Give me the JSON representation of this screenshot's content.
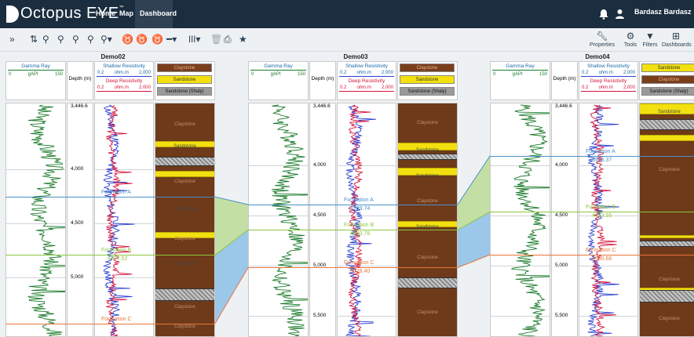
{
  "app": {
    "logo_letter": "B",
    "title": "Octopus EYE",
    "tm": "™"
  },
  "nav": {
    "items": [
      "Home",
      "Map",
      "Dashboard"
    ],
    "active": "Dashboard",
    "user": "Bardasz Bardasz"
  },
  "toolbar": {
    "right": [
      {
        "label": "Properties",
        "icon": "wrench-icon"
      },
      {
        "label": "Tools",
        "icon": "tools-icon"
      },
      {
        "label": "Filters",
        "icon": "filter-icon"
      },
      {
        "label": "Dashboards",
        "icon": "grid-icon"
      }
    ]
  },
  "headers": {
    "gamma": "Gamma Ray",
    "gamma_min": "0",
    "gamma_unit": "gAPI",
    "gamma_max": "150",
    "depth": "Depth (m)",
    "shallow": "Shallow Resistivity",
    "deep": "Deep Resistivity",
    "res_min": "0.2",
    "res_unit": "ohm.m",
    "res_max": "2,000",
    "lith_legend": [
      "Claystone",
      "Sandstone",
      "Sandstone (Shaly)"
    ]
  },
  "wells": [
    {
      "name": "Demo02",
      "top_depth": "3,446.6",
      "depth_labels": [
        "4,000",
        "4,500",
        "5,000"
      ],
      "legend_order": [
        "Claystone",
        "Sandstone",
        "Sandstone (Shaly)"
      ],
      "formations": [
        {
          "name": "Formation A",
          "depth": ""
        },
        {
          "name": "Formation B",
          "depth": "4797.52"
        },
        {
          "name": "Formation C",
          "depth": ""
        }
      ],
      "lith_labels": [
        "Claystone",
        "Sandstone",
        "Claystone",
        "Sandstone",
        "Claystone",
        "Sandstone",
        "Claystone",
        "Claystone"
      ]
    },
    {
      "name": "Demo03",
      "top_depth": "3,446.6",
      "depth_labels": [
        "4,000",
        "4,500",
        "5,000",
        "5,500"
      ],
      "legend_order": [
        "Claystone",
        "Sandstone",
        "Sandstone (Shaly)"
      ],
      "formations": [
        {
          "name": "Formation A",
          "depth": "4399.74"
        },
        {
          "name": "Formation B",
          "depth": "4650.78"
        },
        {
          "name": "Formation C",
          "depth": "5028.40"
        }
      ],
      "lith_labels": [
        "Claystone",
        "Sandstone",
        "Sandstone",
        "Claystone",
        "Sandstone",
        "Claystone",
        "Claystone"
      ]
    },
    {
      "name": "Demo04",
      "top_depth": "3,446.6",
      "depth_labels": [
        "4,000",
        "4,500",
        "5,000",
        "5,500"
      ],
      "legend_order": [
        "Sandstone",
        "Claystone",
        "Sandstone (Shaly)"
      ],
      "formations": [
        {
          "name": "Formation A",
          "depth": "3916.37"
        },
        {
          "name": "Formation B",
          "depth": "4473.55"
        },
        {
          "name": "Formation C",
          "depth": "4900.66"
        }
      ],
      "lith_labels": [
        "Sandstone",
        "Claystone",
        "Claystone",
        "Claystone"
      ]
    }
  ],
  "colors": {
    "nav": "#1b2e3f",
    "formation_a": "#4a90c8",
    "formation_b": "#8cc63f",
    "formation_c": "#e8763a",
    "gamma": "#1a7a2a",
    "shallow": "#d4143c",
    "deep": "#2a3fd0",
    "clay": "#7a3e1c",
    "sand": "#f2e010"
  }
}
